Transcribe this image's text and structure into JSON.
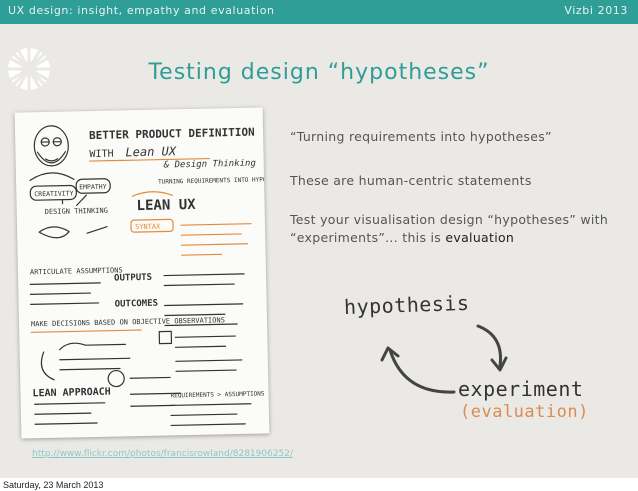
{
  "header": {
    "title": "UX design: insight, empathy and evaluation",
    "brand": "Vizbi 2013"
  },
  "slide": {
    "title": "Testing design “hypotheses”",
    "bullets": [
      "“Turning requirements into hypotheses”",
      "These are human-centric statements",
      "Test your visualisation design “hypotheses” with “experiments”... this is "
    ],
    "bullet_emphasis": "evaluation",
    "diagram": {
      "hypothesis": "hypothesis",
      "experiment": "experiment",
      "evaluation": "(evaluation)"
    },
    "credit_link": "http://www.flickr.com/photos/francisrowland/8281906252/"
  },
  "sketch": {
    "title": "BETTER PRODUCT DEFINITION",
    "with": "WITH",
    "lean": "Lean UX",
    "design": "& Design Thinking",
    "creativity": "CREATIVITY",
    "empathy": "EMPATHY",
    "design_thinking": "DESIGN THINKING",
    "lean_ux": "LEAN UX",
    "syntax": "SYNTAX",
    "outputs": "OUTPUTS",
    "outcomes": "OUTCOMES",
    "make_decisions": "MAKE DECISIONS BASED ON OBJECTIVE OBSERVATIONS",
    "articulate": "ARTICULATE ASSUMPTIONS",
    "lean_approach": "LEAN APPROACH",
    "requirements": "REQUIREMENTS > ASSUMPTIONS",
    "quote": "TURNING REQUIREMENTS INTO HYPOTHESES"
  },
  "footer": {
    "date": "Saturday, 23 March 2013"
  },
  "colors": {
    "teal": "#2e9e96",
    "background": "#ebe9e6",
    "accent_orange": "#d88d52"
  }
}
